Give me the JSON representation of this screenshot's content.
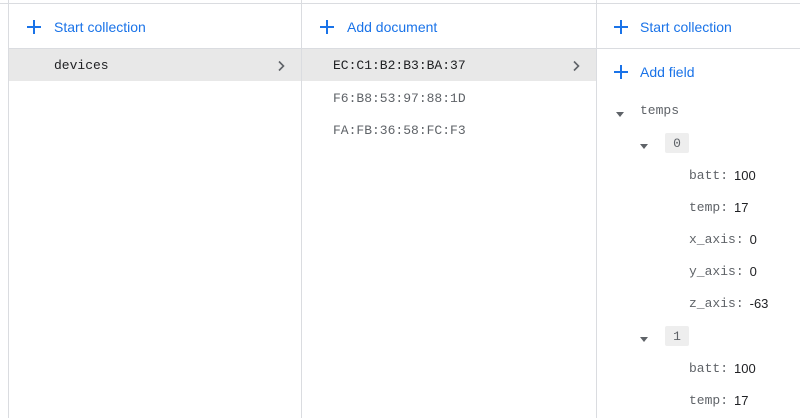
{
  "collections_panel": {
    "action_label": "Start collection",
    "items": [
      {
        "label": "devices"
      }
    ]
  },
  "documents_panel": {
    "action_label": "Add document",
    "items": [
      {
        "label": "EC:C1:B2:B3:BA:37"
      },
      {
        "label": "F6:B8:53:97:88:1D"
      },
      {
        "label": "FA:FB:36:58:FC:F3"
      }
    ]
  },
  "fields_panel": {
    "start_collection_label": "Start collection",
    "add_field_label": "Add field",
    "array_key": "temps",
    "entries": [
      {
        "index": "0",
        "fields": [
          {
            "key": "batt",
            "value": "100"
          },
          {
            "key": "temp",
            "value": "17"
          },
          {
            "key": "x_axis",
            "value": "0"
          },
          {
            "key": "y_axis",
            "value": "0"
          },
          {
            "key": "z_axis",
            "value": "-63"
          }
        ]
      },
      {
        "index": "1",
        "fields": [
          {
            "key": "batt",
            "value": "100"
          },
          {
            "key": "temp",
            "value": "17"
          }
        ]
      }
    ]
  },
  "colors": {
    "accent": "#1a73e8",
    "selected_row": "#e8e8e8",
    "border": "#dadce0"
  },
  "icons": {
    "add": "plus-icon",
    "navigate": "chevron-right-icon",
    "expand": "caret-down-icon"
  }
}
